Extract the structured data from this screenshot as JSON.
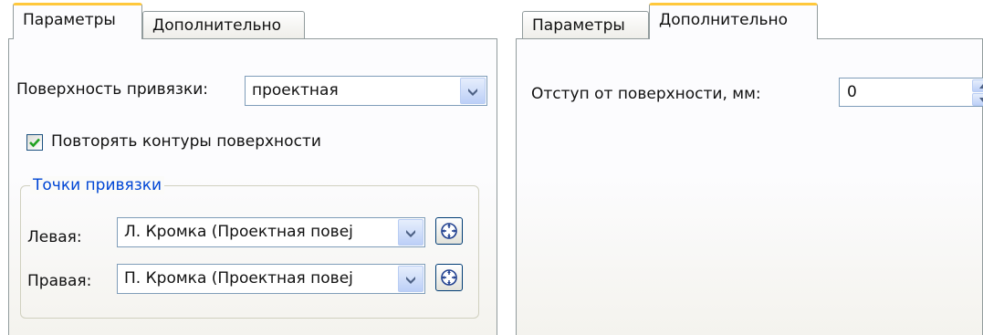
{
  "left_panel": {
    "tabs": [
      {
        "label": "Параметры",
        "active": true
      },
      {
        "label": "Дополнительно",
        "active": false
      }
    ],
    "surface_label": "Поверхность привязки:",
    "surface_value": "проектная",
    "repeat_contours": {
      "label": "Повторять контуры поверхности",
      "checked": true
    },
    "anchor_points": {
      "title": "Точки привязки",
      "left_label": "Левая:",
      "left_value": "Л. Кромка (Проектная повеј",
      "right_label": "Правая:",
      "right_value": "П. Кромка (Проектная повеј"
    }
  },
  "right_panel": {
    "tabs": [
      {
        "label": "Параметры",
        "active": false
      },
      {
        "label": "Дополнительно",
        "active": true
      }
    ],
    "offset_label": "Отступ от поверхности, мм:",
    "offset_value": "0"
  },
  "colors": {
    "tab_highlight": "#ffc83c",
    "group_title": "#0046d5",
    "checkmark": "#21a121",
    "dropdown_arrow": "#4d6185",
    "pick_icon": "#1f3f8f"
  },
  "icons": [
    "chevron-down-icon",
    "checkmark-icon",
    "crosshair-icon",
    "spin-up-icon",
    "spin-down-icon"
  ]
}
